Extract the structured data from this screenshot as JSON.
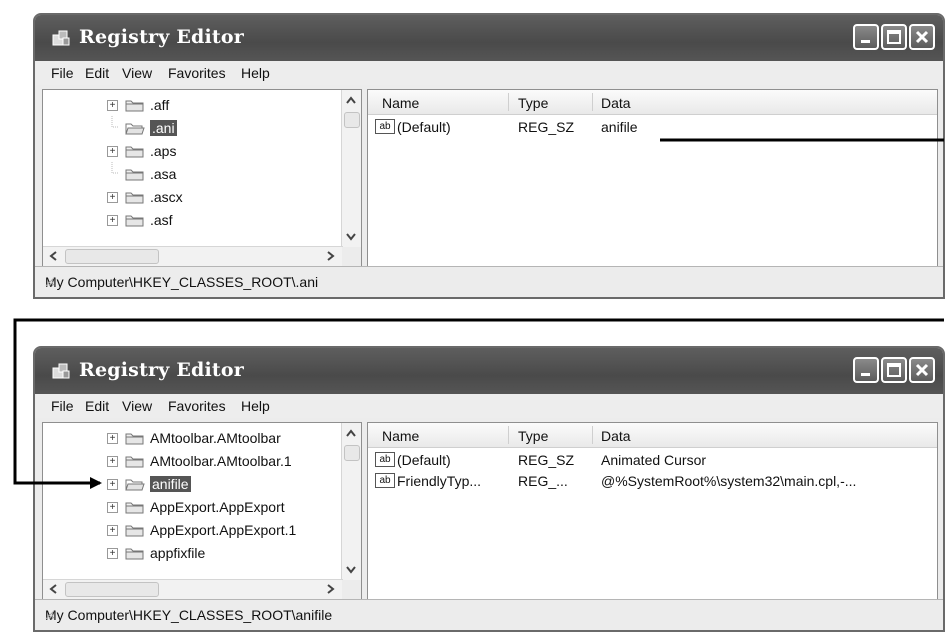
{
  "windows": [
    {
      "title": "Registry Editor",
      "menu": [
        "File",
        "Edit",
        "View",
        "Favorites",
        "Help"
      ],
      "tree_items": [
        {
          "label": ".aff",
          "expandable": true,
          "selected": false
        },
        {
          "label": ".ani",
          "expandable": false,
          "selected": true
        },
        {
          "label": ".aps",
          "expandable": true,
          "selected": false
        },
        {
          "label": ".asa",
          "expandable": false,
          "selected": false
        },
        {
          "label": ".ascx",
          "expandable": true,
          "selected": false
        },
        {
          "label": ".asf",
          "expandable": true,
          "selected": false
        }
      ],
      "columns": [
        "Name",
        "Type",
        "Data"
      ],
      "values": [
        {
          "name": "(Default)",
          "type": "REG_SZ",
          "data": "anifile"
        }
      ],
      "status": "My Computer\\HKEY_CLASSES_ROOT\\.ani"
    },
    {
      "title": "Registry Editor",
      "menu": [
        "File",
        "Edit",
        "View",
        "Favorites",
        "Help"
      ],
      "tree_items": [
        {
          "label": "AMtoolbar.AMtoolbar",
          "expandable": true,
          "selected": false
        },
        {
          "label": "AMtoolbar.AMtoolbar.1",
          "expandable": true,
          "selected": false
        },
        {
          "label": "anifile",
          "expandable": true,
          "selected": true
        },
        {
          "label": "AppExport.AppExport",
          "expandable": true,
          "selected": false
        },
        {
          "label": "AppExport.AppExport.1",
          "expandable": true,
          "selected": false
        },
        {
          "label": "appfixfile",
          "expandable": true,
          "selected": false
        }
      ],
      "columns": [
        "Name",
        "Type",
        "Data"
      ],
      "values": [
        {
          "name": "(Default)",
          "type": "REG_SZ",
          "data": "Animated Cursor"
        },
        {
          "name": "FriendlyTyp...",
          "type": "REG_...",
          "data": "@%SystemRoot%\\system32\\main.cpl,-..."
        }
      ],
      "status": "My Computer\\HKEY_CLASSES_ROOT\\anifile"
    }
  ],
  "icons": {
    "app": "registry-editor-icon",
    "value": "string-value-icon",
    "folder": "folder-icon",
    "expand": "plus-expander-icon"
  },
  "colors": {
    "titlebar": "#555555",
    "selection": "#555555",
    "arrow": "#000000"
  }
}
